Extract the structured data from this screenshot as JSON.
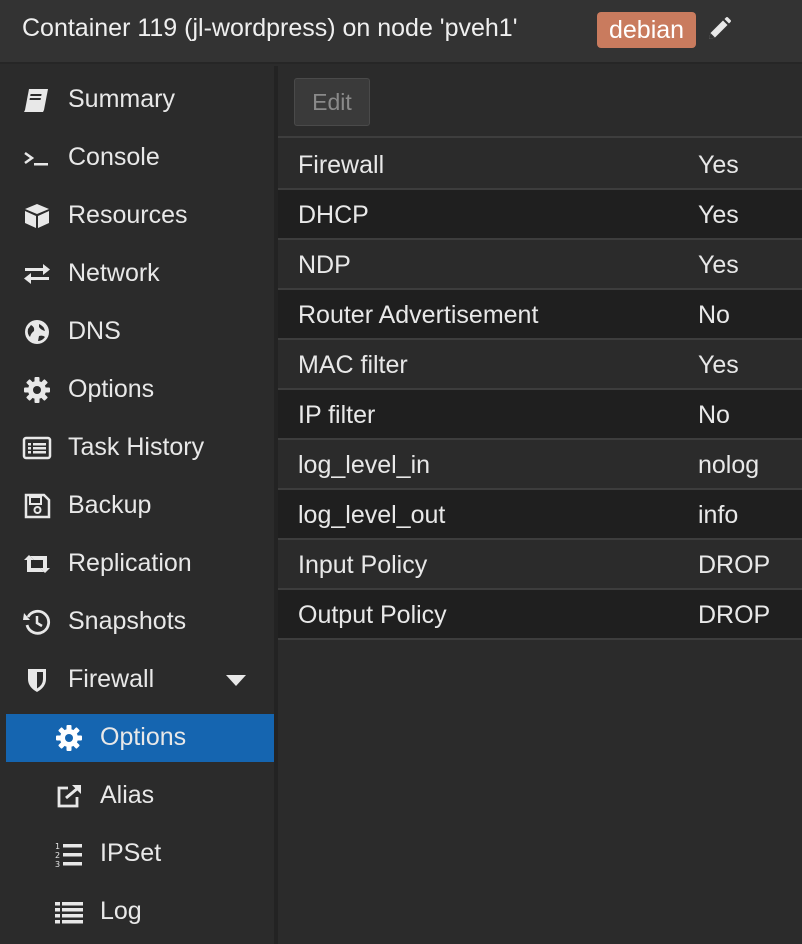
{
  "header": {
    "title": "Container 119 (jl-wordpress) on node 'pveh1'",
    "tag": "debian",
    "tag_color": "#c97b5e",
    "edit_icon": "pencil-icon"
  },
  "sidebar": {
    "items": [
      {
        "label": "Summary",
        "icon": "book-icon"
      },
      {
        "label": "Console",
        "icon": "terminal-icon"
      },
      {
        "label": "Resources",
        "icon": "cube-icon"
      },
      {
        "label": "Network",
        "icon": "exchange-icon"
      },
      {
        "label": "DNS",
        "icon": "globe-icon"
      },
      {
        "label": "Options",
        "icon": "gear-icon"
      },
      {
        "label": "Task History",
        "icon": "list-alt-icon"
      },
      {
        "label": "Backup",
        "icon": "floppy-icon"
      },
      {
        "label": "Replication",
        "icon": "retweet-icon"
      },
      {
        "label": "Snapshots",
        "icon": "history-icon"
      },
      {
        "label": "Firewall",
        "icon": "shield-icon",
        "expanded": true
      },
      {
        "label": "Options",
        "icon": "gear-icon",
        "selected": true
      },
      {
        "label": "Alias",
        "icon": "external-link-icon"
      },
      {
        "label": "IPSet",
        "icon": "list-ol-icon"
      },
      {
        "label": "Log",
        "icon": "list-icon"
      }
    ],
    "selected_color": "#1565b0"
  },
  "toolbar": {
    "edit_label": "Edit"
  },
  "grid": {
    "rows": [
      {
        "key": "Firewall",
        "value": "Yes"
      },
      {
        "key": "DHCP",
        "value": "Yes"
      },
      {
        "key": "NDP",
        "value": "Yes"
      },
      {
        "key": "Router Advertisement",
        "value": "No"
      },
      {
        "key": "MAC filter",
        "value": "Yes"
      },
      {
        "key": "IP filter",
        "value": "No"
      },
      {
        "key": "log_level_in",
        "value": "nolog"
      },
      {
        "key": "log_level_out",
        "value": "info"
      },
      {
        "key": "Input Policy",
        "value": "DROP"
      },
      {
        "key": "Output Policy",
        "value": "DROP"
      }
    ]
  }
}
